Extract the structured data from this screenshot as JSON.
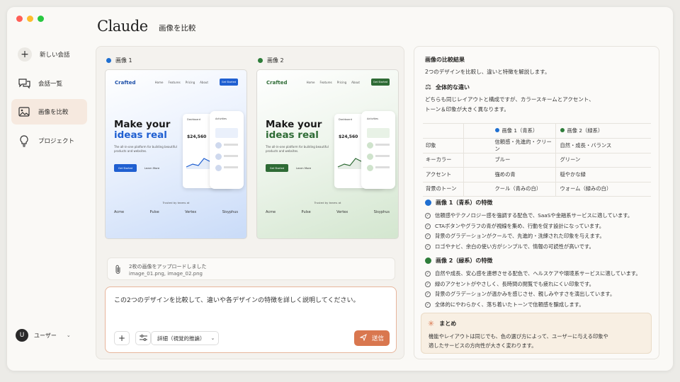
{
  "window": {
    "colors": {
      "close": "#ff5f57",
      "minimize": "#febc2e",
      "maximize": "#28c840"
    }
  },
  "sidebar": {
    "items": [
      {
        "label": "新しい会話",
        "icon": "plus-icon"
      },
      {
        "label": "会話一覧",
        "icon": "chat-bubbles-icon"
      },
      {
        "label": "画像を比較",
        "icon": "image-icon",
        "active": true
      },
      {
        "label": "プロジェクト",
        "icon": "lightbulb-icon"
      }
    ],
    "user": {
      "initial": "U",
      "name": "ユーザー"
    }
  },
  "header": {
    "logo": "Claude",
    "title": "画像を比較"
  },
  "images": [
    {
      "label": "画像 1",
      "color": "#1f6fd1",
      "mock": {
        "brand": "Crafted",
        "nav": [
          "Home",
          "Features",
          "Pricing",
          "About"
        ],
        "cta": "Get Started",
        "headline_1": "Make your",
        "headline_2": "ideas real",
        "sub": "The all-in-one platform for building beautiful products and websites.",
        "btn": "Get Started",
        "learn": "Learn More",
        "trusted": "Trusted by teams at",
        "logos": [
          "Acme",
          "Pulse",
          "Vertex",
          "Sisyphus"
        ],
        "dash_title": "Dashboard",
        "amount": "$24,560",
        "phone_title": "Activities"
      }
    },
    {
      "label": "画像 2",
      "color": "#2e7d3a",
      "mock": {
        "brand": "Crafted",
        "nav": [
          "Home",
          "Features",
          "Pricing",
          "About"
        ],
        "cta": "Get Started",
        "headline_1": "Make your",
        "headline_2": "ideas real",
        "sub": "The all-in-one platform for building beautiful products and websites.",
        "btn": "Get Started",
        "learn": "Learn More",
        "trusted": "Trusted by teams at",
        "logos": [
          "Acme",
          "Pulse",
          "Vertex",
          "Sisyphus"
        ],
        "dash_title": "Dashboard",
        "amount": "$24,560",
        "phone_title": "Activities"
      }
    }
  ],
  "attachment": {
    "title": "2枚の画像をアップロードしました",
    "files": "image_01.png, image_02.png"
  },
  "prompt": {
    "text": "この2つのデザインを比較して、違いや各デザインの特徴を詳しく説明してください。",
    "mode": "詳細（視覚的推論）",
    "send": "送信"
  },
  "result": {
    "title": "画像の比較結果",
    "intro": "2つのデザインを比較し、違いと特徴を解説します。",
    "overall_heading": "全体的な違い",
    "overall_text_1": "どちらも同じレイアウトと構成ですが、カラースキームとアクセント、",
    "overall_text_2": "トーン＆印象が大きく異なります。",
    "table": {
      "headers": [
        "",
        "画像 1（青系）",
        "画像 2（緑系）"
      ],
      "rows": [
        [
          "印象",
          "信頼感・先進的・クリーン",
          "自然・成長・バランス"
        ],
        [
          "キーカラー",
          "ブルー",
          "グリーン"
        ],
        [
          "アクセント",
          "強めの青",
          "穏やかな緑"
        ],
        [
          "背景のトーン",
          "クール（青みの白）",
          "ウォーム（緑みの白）"
        ]
      ]
    },
    "img1_heading": "画像 1（青系）の特徴",
    "img1_points": [
      "信頼感やテクノロジー感を強調する配色で、SaaSや金融系サービスに適しています。",
      "CTAボタンやグラフの青が視線を集め、行動を促す設計になっています。",
      "背景のグラデーションがクールで、先進的・洗練された印象を与えます。",
      "ロゴやナビ、余白の使い方がシンプルで、情報の可読性が高いです。"
    ],
    "img2_heading": "画像 2（緑系）の特徴",
    "img2_points": [
      "自然や成長、安心感を連想させる配色で、ヘルスケアや環境系サービスに適しています。",
      "緑のアクセントがやさしく、長時間の閲覧でも疲れにくい印象です。",
      "背景のグラデーションが温かみを感じさせ、親しみやすさを演出しています。",
      "全体的にやわらかく、落ち着いたトーンで信頼感を醸成します。"
    ],
    "summary_heading": "まとめ",
    "summary_1": "機能やレイアウトは同じでも、色の選び方によって、ユーザーに与える印象や",
    "summary_2": "適したサービスの方向性が大きく変わります。"
  }
}
